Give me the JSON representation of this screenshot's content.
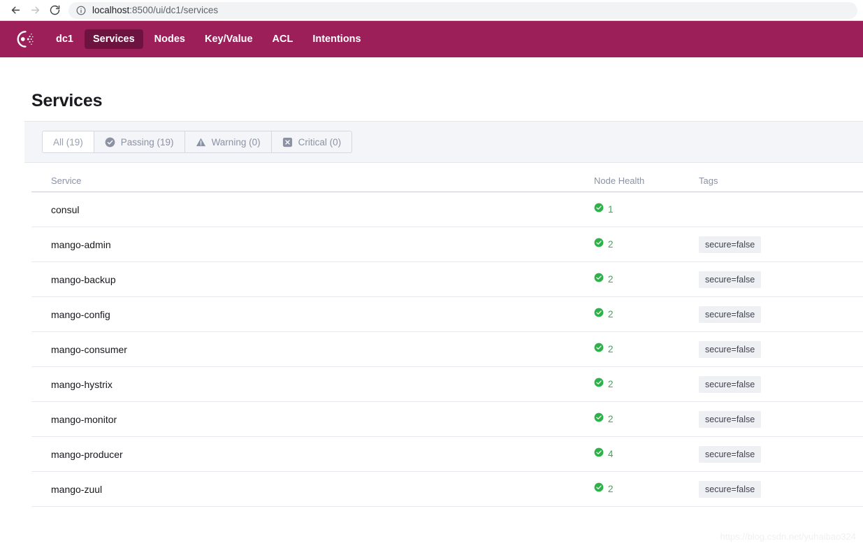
{
  "browser": {
    "back_icon": "arrow-left-icon",
    "forward_icon": "arrow-right-icon",
    "reload_icon": "reload-icon",
    "info_icon": "info-circle-icon",
    "url_host": "localhost",
    "url_path": ":8500/ui/dc1/services"
  },
  "nav": {
    "logo_icon": "consul-logo-icon",
    "brand_color": "#9c1f5a",
    "active_color": "#6d1340",
    "items": [
      {
        "label": "dc1",
        "active": false
      },
      {
        "label": "Services",
        "active": true
      },
      {
        "label": "Nodes",
        "active": false
      },
      {
        "label": "Key/Value",
        "active": false
      },
      {
        "label": "ACL",
        "active": false
      },
      {
        "label": "Intentions",
        "active": false
      }
    ]
  },
  "page": {
    "title": "Services"
  },
  "filters": [
    {
      "label": "All (19)",
      "icon": null,
      "active": true
    },
    {
      "label": "Passing (19)",
      "icon": "check-circle-icon",
      "active": false
    },
    {
      "label": "Warning (0)",
      "icon": "warning-triangle-icon",
      "active": false
    },
    {
      "label": "Critical (0)",
      "icon": "x-square-icon",
      "active": false
    }
  ],
  "table": {
    "columns": [
      "Service",
      "Node Health",
      "Tags"
    ],
    "health_icon": "check-circle-green-icon",
    "health_color": "#2eb14a",
    "rows": [
      {
        "service": "consul",
        "health": "1",
        "tags": []
      },
      {
        "service": "mango-admin",
        "health": "2",
        "tags": [
          "secure=false"
        ]
      },
      {
        "service": "mango-backup",
        "health": "2",
        "tags": [
          "secure=false"
        ]
      },
      {
        "service": "mango-config",
        "health": "2",
        "tags": [
          "secure=false"
        ]
      },
      {
        "service": "mango-consumer",
        "health": "2",
        "tags": [
          "secure=false"
        ]
      },
      {
        "service": "mango-hystrix",
        "health": "2",
        "tags": [
          "secure=false"
        ]
      },
      {
        "service": "mango-monitor",
        "health": "2",
        "tags": [
          "secure=false"
        ]
      },
      {
        "service": "mango-producer",
        "health": "4",
        "tags": [
          "secure=false"
        ]
      },
      {
        "service": "mango-zuul",
        "health": "2",
        "tags": [
          "secure=false"
        ]
      }
    ]
  },
  "watermark": "https://blog.csdn.net/yuhaibao324"
}
